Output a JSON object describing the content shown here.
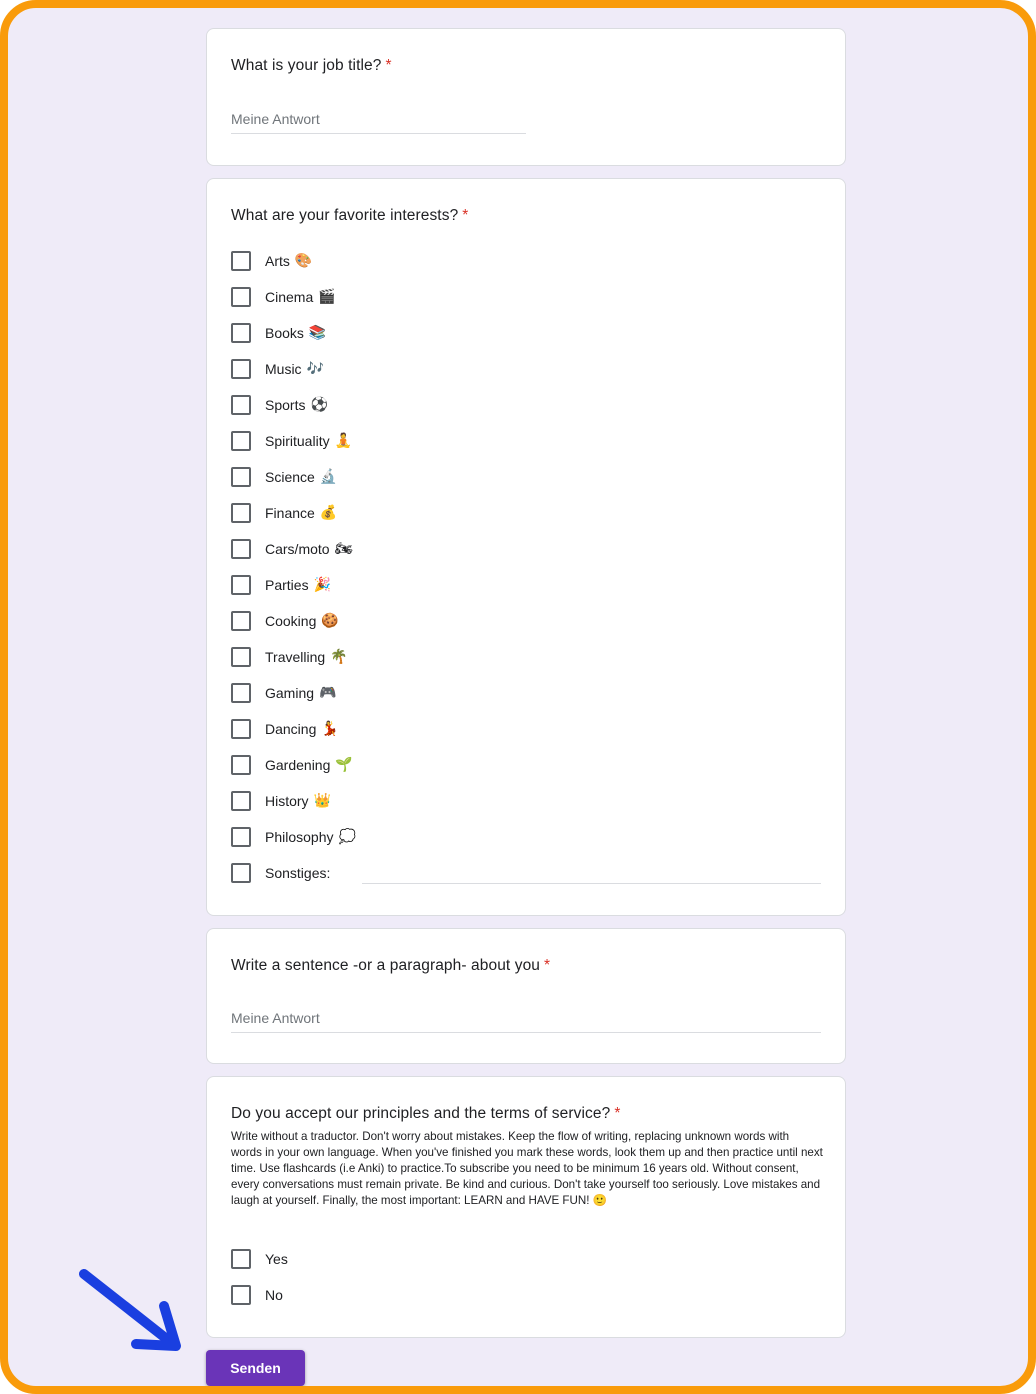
{
  "colors": {
    "frame_border": "#f99b0b",
    "page_background": "#efebf8",
    "submit_button": "#6a34b8",
    "required_asterisk": "#d93025",
    "annotation_arrow": "#1a3fe0"
  },
  "questions": {
    "job": {
      "title": "What is your job title?",
      "required_mark": "*",
      "placeholder": "Meine Antwort"
    },
    "interests": {
      "title": "What are your favorite interests?",
      "required_mark": "*",
      "options": [
        {
          "label": "Arts",
          "emoji": "🎨"
        },
        {
          "label": "Cinema",
          "emoji": "🎬"
        },
        {
          "label": "Books",
          "emoji": "📚"
        },
        {
          "label": "Music",
          "emoji": "🎶"
        },
        {
          "label": "Sports",
          "emoji": "⚽"
        },
        {
          "label": "Spirituality",
          "emoji": "🧘"
        },
        {
          "label": "Science",
          "emoji": "🔬"
        },
        {
          "label": "Finance",
          "emoji": "💰"
        },
        {
          "label": "Cars/moto",
          "emoji": "🏍"
        },
        {
          "label": "Parties",
          "emoji": "🎉"
        },
        {
          "label": "Cooking",
          "emoji": "🍪"
        },
        {
          "label": "Travelling",
          "emoji": "🌴"
        },
        {
          "label": "Gaming",
          "emoji": "🎮"
        },
        {
          "label": "Dancing",
          "emoji": "💃"
        },
        {
          "label": "Gardening",
          "emoji": "🌱"
        },
        {
          "label": "History",
          "emoji": "👑"
        },
        {
          "label": "Philosophy",
          "emoji": "💭"
        }
      ],
      "other_label": "Sonstiges:"
    },
    "about": {
      "title": "Write a sentence -or a paragraph- about you",
      "required_mark": "*",
      "placeholder": "Meine Antwort"
    },
    "terms": {
      "title": "Do you accept our principles and the terms of service?",
      "required_mark": "*",
      "description": "Write without a traductor. Don't worry about mistakes. Keep the flow of writing, replacing unknown words with words in your own language. When you've finished you mark these words, look them up and then practice until next time. Use flashcards (i.e Anki) to practice.To subscribe you need to be minimum 16 years old. Without consent, every conversations must remain private. Be kind and curious. Don't take yourself too seriously. Love mistakes and laugh at yourself. Finally, the most important: LEARN and HAVE FUN! 🙂",
      "option_yes": "Yes",
      "option_no": "No"
    }
  },
  "submit_label": "Senden"
}
